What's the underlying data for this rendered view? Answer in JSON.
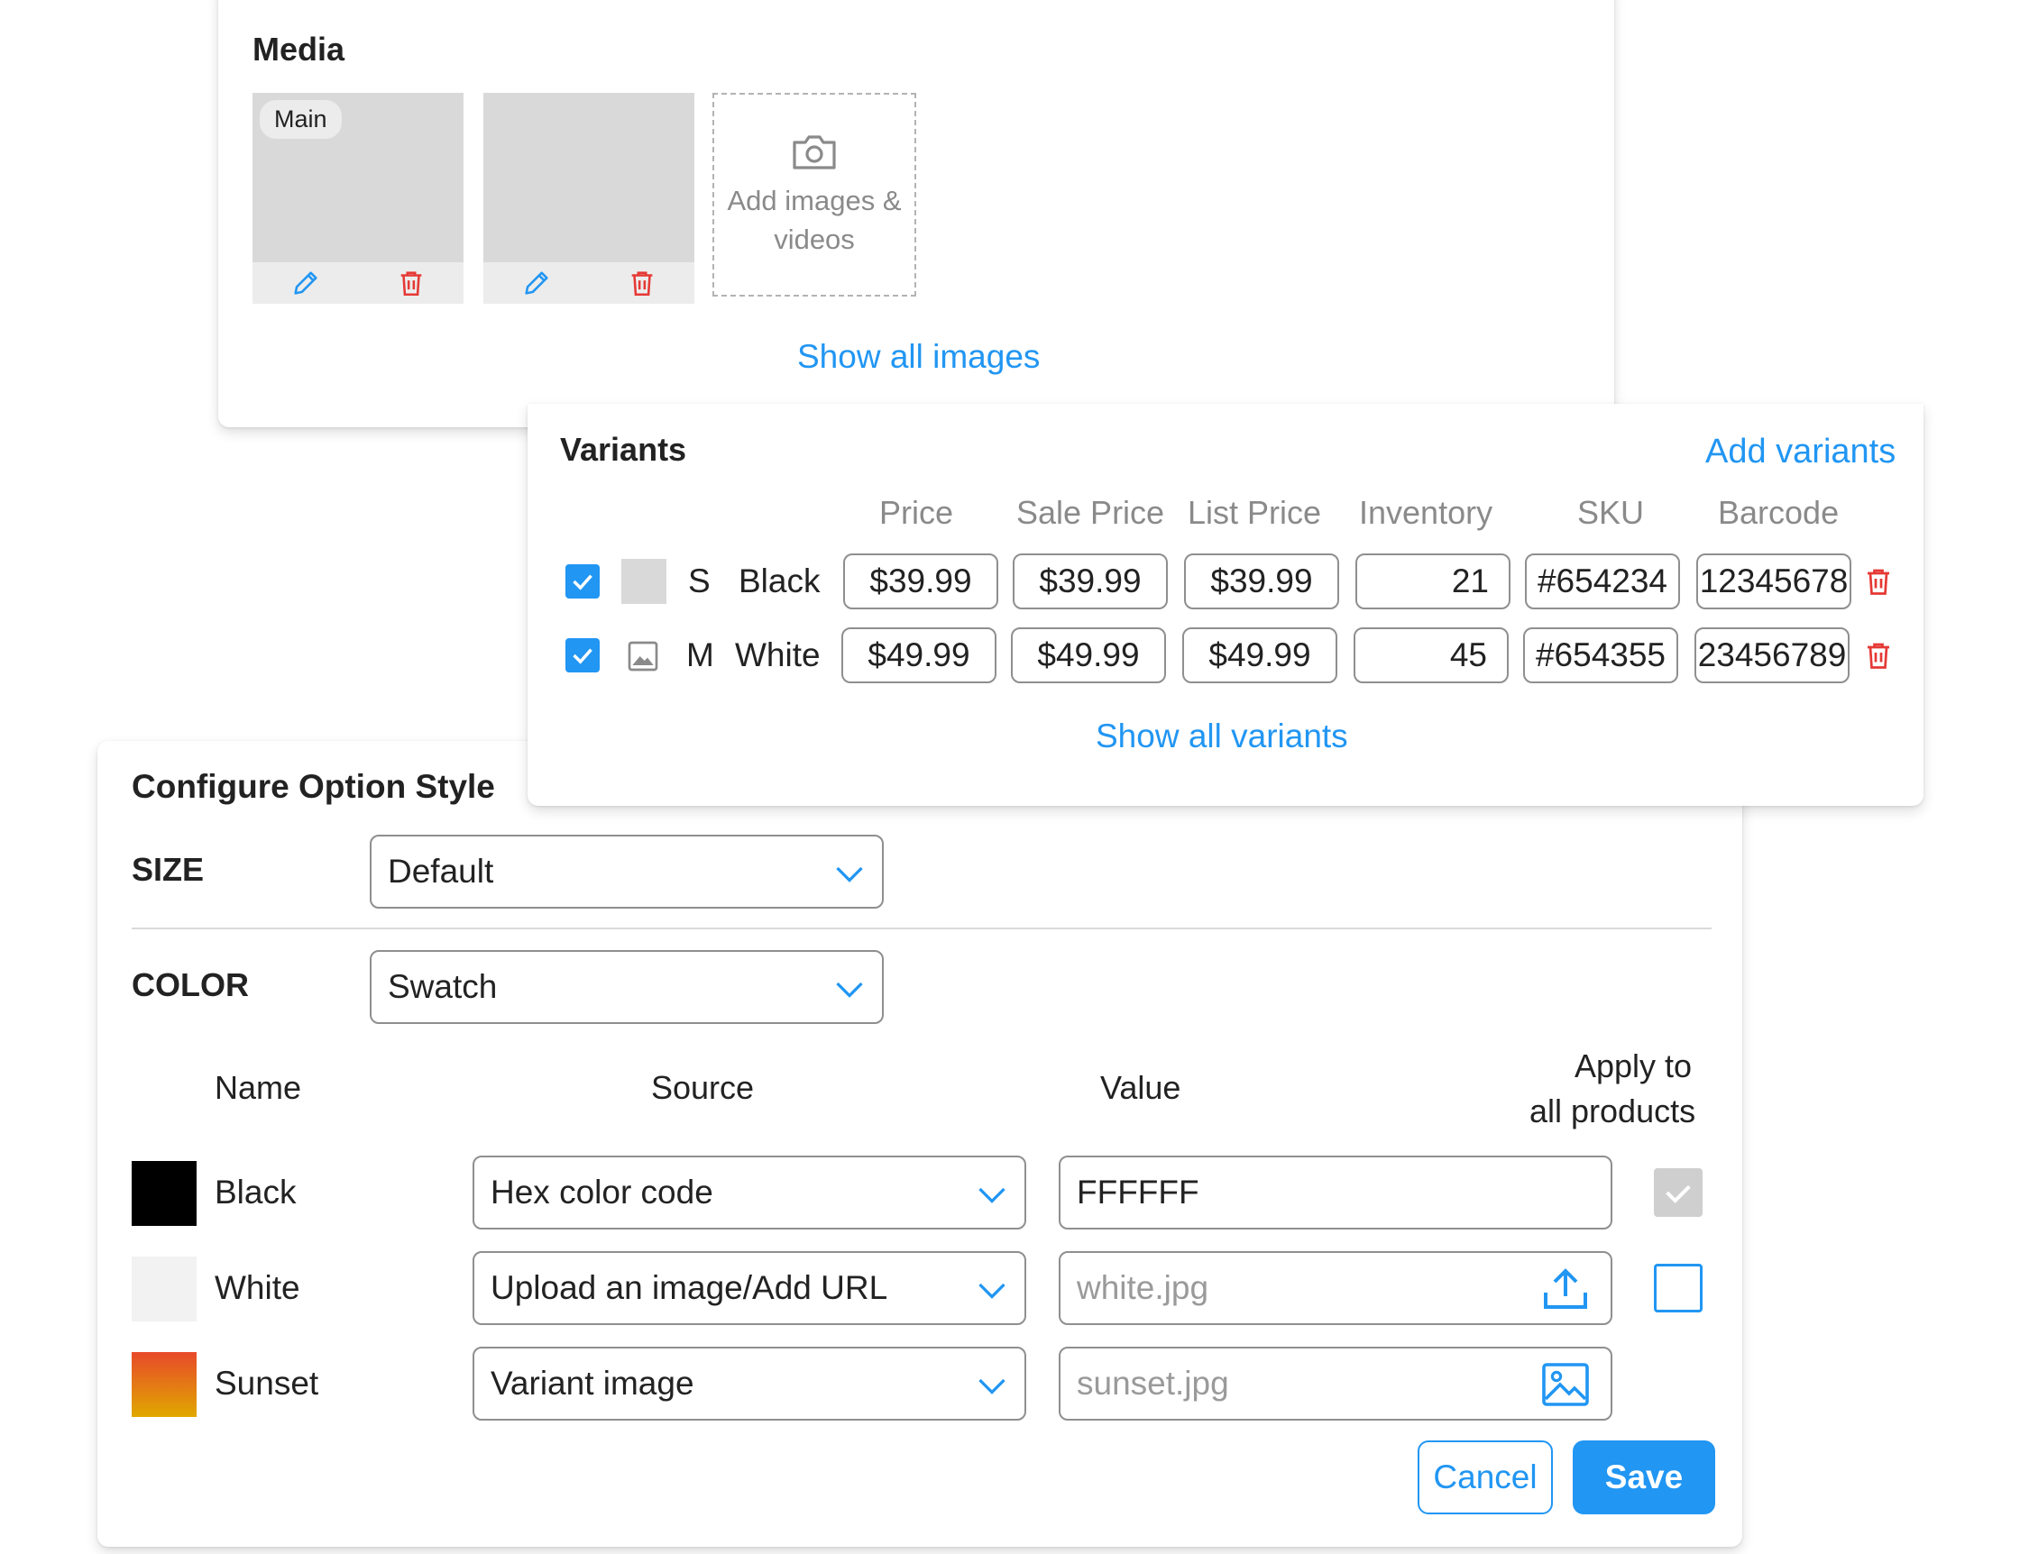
{
  "media": {
    "title": "Media",
    "main_badge": "Main",
    "add_line1": "Add images &",
    "add_line2": "videos",
    "show_all": "Show all images"
  },
  "variants": {
    "title": "Variants",
    "add_link": "Add variants",
    "columns": [
      "Price",
      "Sale Price",
      "List Price",
      "Inventory",
      "SKU",
      "Barcode"
    ],
    "rows": [
      {
        "size": "S",
        "color": "Black",
        "price": "$39.99",
        "sale_price": "$39.99",
        "list_price": "$39.99",
        "inventory": "21",
        "sku": "#654234",
        "barcode": "12345678",
        "checked": true
      },
      {
        "size": "M",
        "color": "White",
        "price": "$49.99",
        "sale_price": "$49.99",
        "list_price": "$49.99",
        "inventory": "45",
        "sku": "#654355",
        "barcode": "23456789",
        "checked": true
      }
    ],
    "show_all": "Show all variants"
  },
  "config": {
    "title": "Configure Option Style",
    "size_label": "SIZE",
    "size_value": "Default",
    "color_label": "COLOR",
    "color_value": "Swatch",
    "headers": {
      "name": "Name",
      "source": "Source",
      "value": "Value",
      "apply_line1": "Apply to",
      "apply_line2": "all products"
    },
    "rows": [
      {
        "name": "Black",
        "source": "Hex color code",
        "value": "FFFFFF",
        "swatch": "#000000"
      },
      {
        "name": "White",
        "source": "Upload an image/Add URL",
        "value": "white.jpg",
        "swatch": "#f2f2f2"
      },
      {
        "name": "Sunset",
        "source": "Variant image",
        "value": "sunset.jpg",
        "swatch_from": "#e8492a",
        "swatch_to": "#e0a800"
      }
    ],
    "cancel": "Cancel",
    "save": "Save"
  },
  "colors": {
    "accent": "#2196f3",
    "danger": "#e53935"
  }
}
